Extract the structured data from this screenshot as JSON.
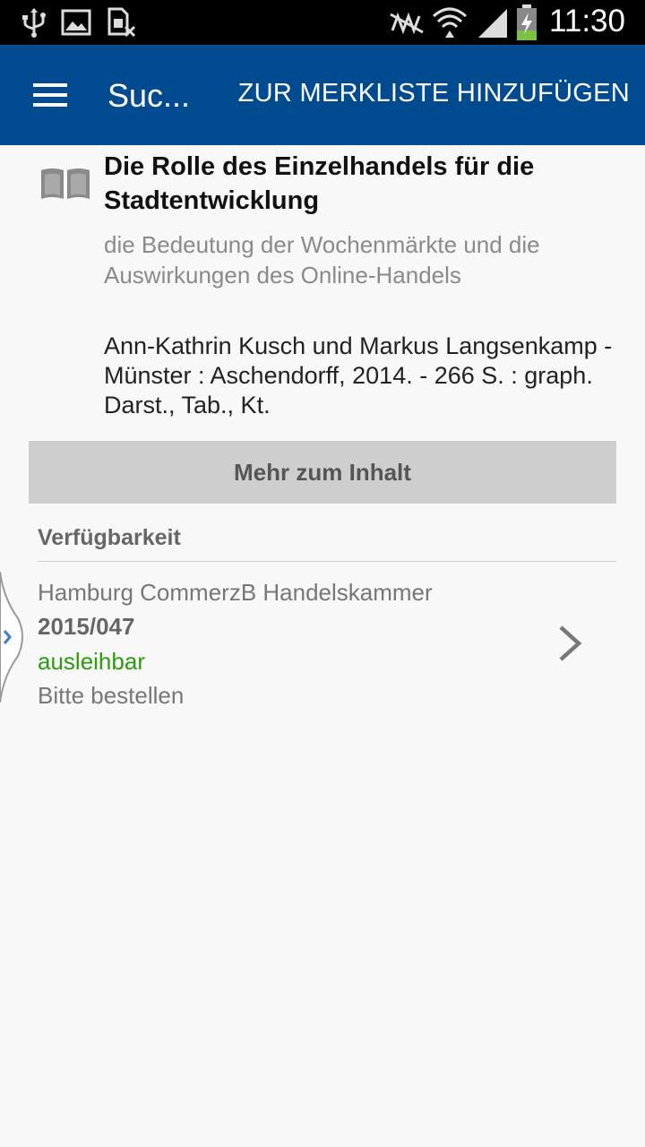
{
  "status_bar": {
    "time": "11:30",
    "icons": [
      "usb-icon",
      "image-icon",
      "sim-card-icon",
      "nfc-mute-icon",
      "wifi-icon",
      "signal-icon",
      "battery-charging-icon"
    ]
  },
  "app_bar": {
    "menu_icon": "hamburger-menu-icon",
    "title": "Suc...",
    "action_label": "ZUR MERKLISTE HINZUFÜGEN",
    "color": "#004a8f"
  },
  "record": {
    "media_icon": "book-icon",
    "title": "Die Rolle des Einzelhandels für die Stadtentwicklung",
    "subtitle": "die Bedeutung der Wochenmärkte und die Auswirkungen des Online-Handels",
    "description": "Ann-Kathrin Kusch und Markus Langsenkamp - Münster : Aschendorff, 2014. - 266 S. : graph. Darst., Tab., Kt."
  },
  "more_button_label": "Mehr zum Inhalt",
  "availability": {
    "heading": "Verfügbarkeit",
    "items": [
      {
        "library": "Hamburg CommerzB Handelskammer",
        "call_number": "2015/047",
        "status": "ausleihbar",
        "status_color": "#2e9a10",
        "action": "Bitte bestellen"
      }
    ]
  }
}
